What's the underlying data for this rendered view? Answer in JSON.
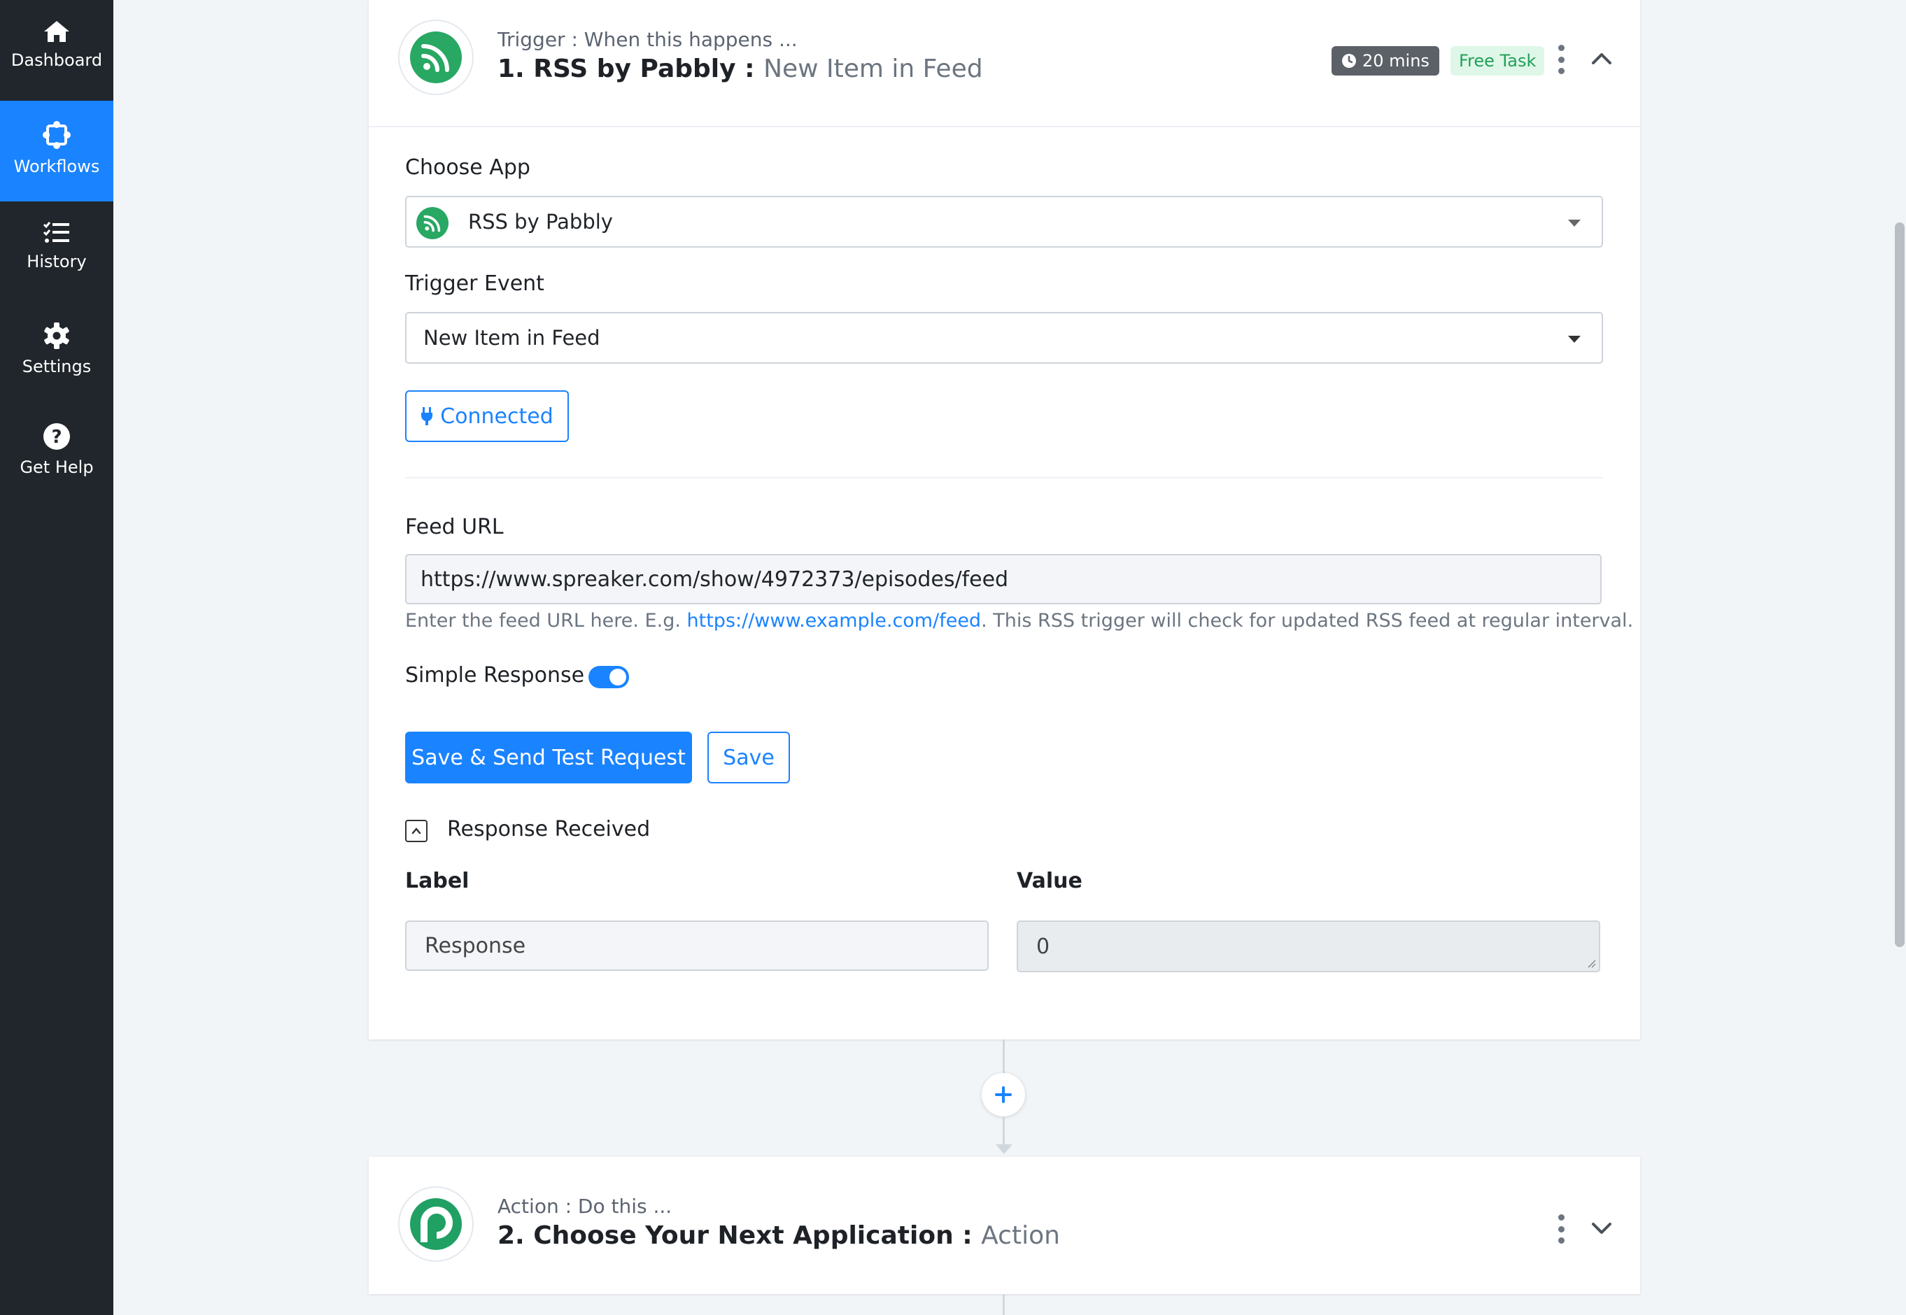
{
  "sidebar": {
    "items": [
      {
        "label": "Dashboard",
        "icon": "home-icon",
        "active": false
      },
      {
        "label": "Workflows",
        "icon": "workflow-icon",
        "active": true
      },
      {
        "label": "History",
        "icon": "list-check-icon",
        "active": false
      },
      {
        "label": "Settings",
        "icon": "gear-icon",
        "active": false
      },
      {
        "label": "Get Help",
        "icon": "question-circle-icon",
        "active": false
      }
    ]
  },
  "trigger": {
    "subtitle": "Trigger : When this happens ...",
    "title": "1. RSS by Pabbly :",
    "title_event": "New Item in Feed",
    "time_badge": "20 mins",
    "free_badge": "Free Task",
    "choose_app_label": "Choose App",
    "choose_app_value": "RSS by Pabbly",
    "trigger_event_label": "Trigger Event",
    "trigger_event_value": "New Item in Feed",
    "connected_label": "Connected",
    "feed_url_label": "Feed URL",
    "feed_url_value": "https://www.spreaker.com/show/4972373/episodes/feed",
    "help_prefix": "Enter the feed URL here. E.g.",
    "help_link": "https://www.example.com/feed",
    "help_suffix": ". This RSS trigger will check for updated RSS feed at regular interval.",
    "simple_response_label": "Simple Response",
    "simple_response_on": true,
    "save_test_label": "Save & Send Test Request",
    "save_label": "Save",
    "response_received_label": "Response Received",
    "col_label": "Label",
    "col_value": "Value",
    "row_label": "Response",
    "row_value": "0"
  },
  "action": {
    "subtitle": "Action : Do this ...",
    "title": "2. Choose Your Next Application :",
    "title_event": "Action"
  },
  "colors": {
    "sidebar_bg": "#20262b",
    "accent": "#1a83ff",
    "rss_green": "#28a863",
    "page_bg": "#f2f5f8"
  }
}
